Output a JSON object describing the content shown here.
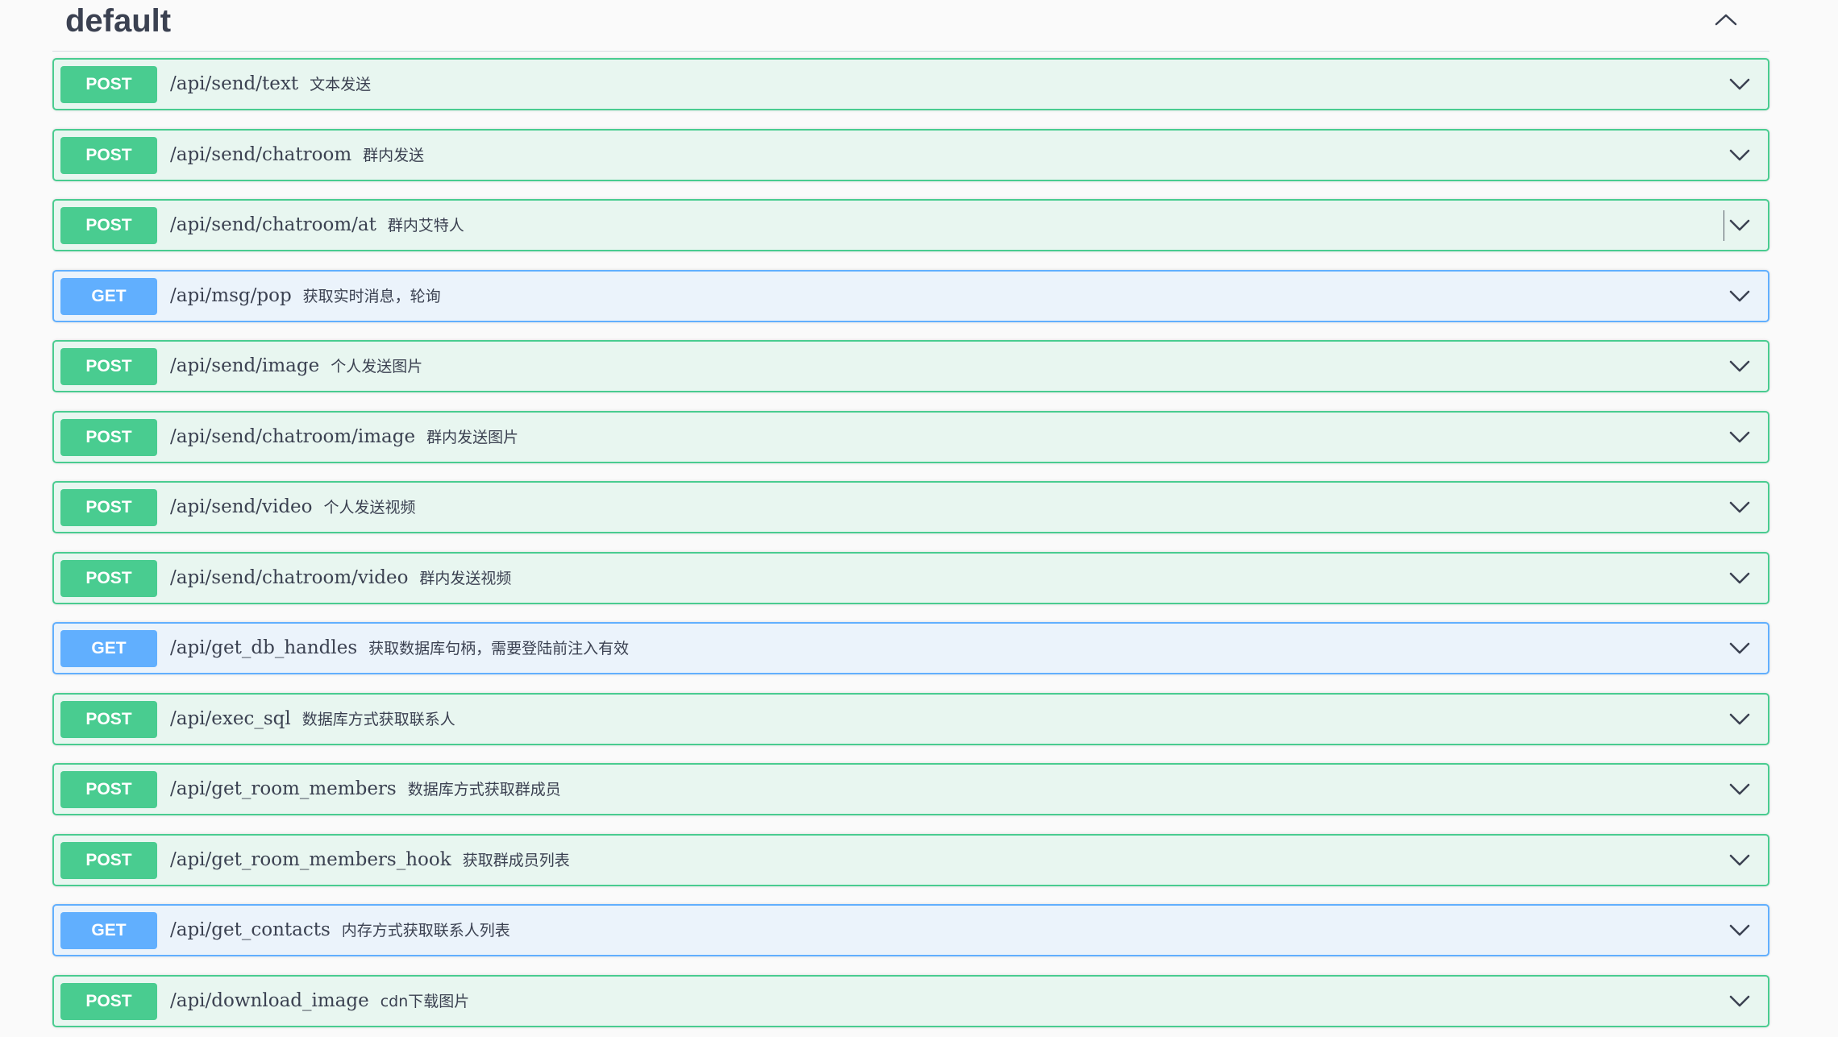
{
  "section": {
    "title": "default"
  },
  "operations": [
    {
      "method": "POST",
      "path": "/api/send/text",
      "summary": "文本发送"
    },
    {
      "method": "POST",
      "path": "/api/send/chatroom",
      "summary": "群内发送"
    },
    {
      "method": "POST",
      "path": "/api/send/chatroom/at",
      "summary": "群内艾特人"
    },
    {
      "method": "GET",
      "path": "/api/msg/pop",
      "summary": "获取实时消息，轮询"
    },
    {
      "method": "POST",
      "path": "/api/send/image",
      "summary": "个人发送图片"
    },
    {
      "method": "POST",
      "path": "/api/send/chatroom/image",
      "summary": "群内发送图片"
    },
    {
      "method": "POST",
      "path": "/api/send/video",
      "summary": "个人发送视频"
    },
    {
      "method": "POST",
      "path": "/api/send/chatroom/video",
      "summary": "群内发送视频"
    },
    {
      "method": "GET",
      "path": "/api/get_db_handles",
      "summary": "获取数据库句柄，需要登陆前注入有效"
    },
    {
      "method": "POST",
      "path": "/api/exec_sql",
      "summary": "数据库方式获取联系人"
    },
    {
      "method": "POST",
      "path": "/api/get_room_members",
      "summary": "数据库方式获取群成员"
    },
    {
      "method": "POST",
      "path": "/api/get_room_members_hook",
      "summary": "获取群成员列表"
    },
    {
      "method": "GET",
      "path": "/api/get_contacts",
      "summary": "内存方式获取联系人列表"
    },
    {
      "method": "POST",
      "path": "/api/download_image",
      "summary": "cdn下载图片"
    }
  ],
  "colors": {
    "post": "#49cc90",
    "get": "#61affe",
    "text": "#3b4151"
  },
  "icons": {
    "collapse": "chevron-up-icon",
    "expand": "chevron-down-icon"
  }
}
